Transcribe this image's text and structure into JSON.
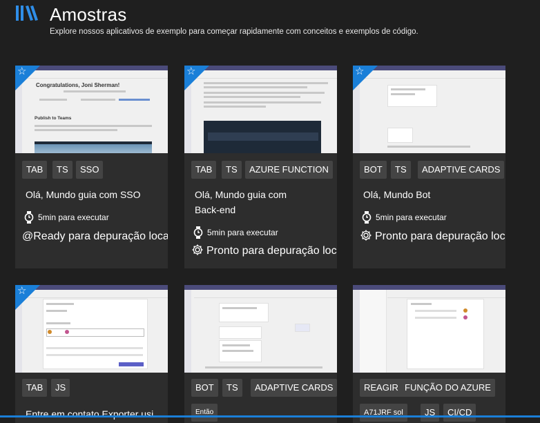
{
  "header": {
    "title": "Amostras",
    "subtitle": "Explore nossos aplicativos de exemplo para começar rapidamente com conceitos e exemplos de código."
  },
  "colors": {
    "accent": "#1a7fd8",
    "card": "#2d2d2d",
    "tag": "#444444",
    "background": "#1f1f1f"
  },
  "cards": [
    {
      "thumb_heading": "Congratulations, Joni Sherman!",
      "thumb_subheading": "Publish to Teams",
      "tags": [
        "TAB",
        "TS",
        "SSO"
      ],
      "title": "Olá, Mundo guia com SSO",
      "time": "5min para executar",
      "status": "@Ready para depuração local"
    },
    {
      "tags": [
        "TAB",
        "TS",
        "AZURE FUNCTION"
      ],
      "title": "Olá, Mundo guia com Back-end",
      "time": "5min para executar",
      "status": "Pronto para depuração local"
    },
    {
      "tags": [
        "BOT",
        "TS",
        "ADAPTIVE CARDS"
      ],
      "title": "Olá, Mundo Bot",
      "time": "5min para executar",
      "status": "Pronto para depuração local"
    },
    {
      "tags": [
        "TAB",
        "JS"
      ],
      "title": "Entre em contato Exporter usi"
    },
    {
      "tags": [
        "BOT",
        "TS",
        "ADAPTIVE CARDS",
        "Então"
      ]
    },
    {
      "tags": [
        "REAGIR",
        "FUNÇÃO DO AZURE",
        "A71JRF sol",
        "JS",
        "CI/CD"
      ]
    }
  ]
}
